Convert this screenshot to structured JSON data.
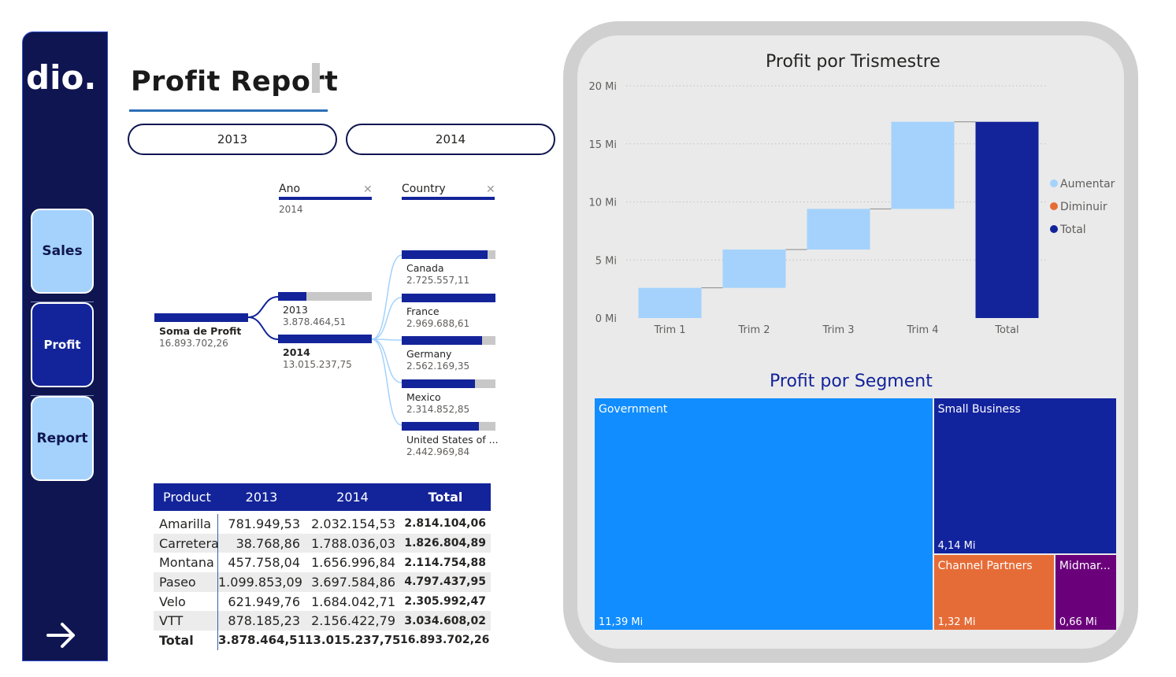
{
  "sidebar": {
    "logo_text": "dio.",
    "nav": [
      {
        "label": "Sales"
      },
      {
        "label": "Profit"
      },
      {
        "label": "Report"
      }
    ]
  },
  "header": {
    "title": "Profit Report"
  },
  "year_buttons": [
    "2013",
    "2014"
  ],
  "decomposition": {
    "levels": [
      {
        "label": "Ano",
        "selected": "2014"
      },
      {
        "label": "Country",
        "selected": ""
      }
    ],
    "root": {
      "name": "Soma de Profit",
      "value": "16.893.702,26"
    },
    "years": [
      {
        "name": "2013",
        "value": "3.878.464,51",
        "fill": 0.3
      },
      {
        "name": "2014",
        "value": "13.015.237,75",
        "fill": 1.0
      }
    ],
    "countries": [
      {
        "name": "Canada",
        "value": "2.725.557,11",
        "fill": 0.92
      },
      {
        "name": "France",
        "value": "2.969.688,61",
        "fill": 1.0
      },
      {
        "name": "Germany",
        "value": "2.562.169,35",
        "fill": 0.86
      },
      {
        "name": "Mexico",
        "value": "2.314.852,85",
        "fill": 0.78
      },
      {
        "name": "United States of ...",
        "value": "2.442.969,84",
        "fill": 0.82
      }
    ]
  },
  "table": {
    "headers": [
      "Product",
      "2013",
      "2014",
      "Total"
    ],
    "rows": [
      [
        "Amarilla",
        "781.949,53",
        "2.032.154,53",
        "2.814.104,06"
      ],
      [
        "Carretera",
        "38.768,86",
        "1.788.036,03",
        "1.826.804,89"
      ],
      [
        "Montana",
        "457.758,04",
        "1.656.996,84",
        "2.114.754,88"
      ],
      [
        "Paseo",
        "1.099.853,09",
        "3.697.584,86",
        "4.797.437,95"
      ],
      [
        "Velo",
        "621.949,76",
        "1.684.042,71",
        "2.305.992,47"
      ],
      [
        "VTT",
        "878.185,23",
        "2.156.422,79",
        "3.034.608,02"
      ]
    ],
    "total": [
      "Total",
      "3.878.464,51",
      "13.015.237,75",
      "16.893.702,26"
    ]
  },
  "waterfall_title": "Profit por Trismestre",
  "treemap_title": "Profit por Segment",
  "chart_data": [
    {
      "type": "bar",
      "subtype": "waterfall",
      "title": "Profit por Trismestre",
      "categories": [
        "Trim 1",
        "Trim 2",
        "Trim 3",
        "Trim 4",
        "Total"
      ],
      "steps": [
        2.6,
        3.3,
        3.5,
        7.5,
        16.9
      ],
      "kinds": [
        "Aumentar",
        "Aumentar",
        "Aumentar",
        "Aumentar",
        "Total"
      ],
      "ylim": [
        0,
        20
      ],
      "yticks": [
        0,
        5,
        10,
        15,
        20
      ],
      "ytick_labels": [
        "0 Mi",
        "5 Mi",
        "10 Mi",
        "15 Mi",
        "20 Mi"
      ],
      "legend": [
        {
          "name": "Aumentar",
          "color": "#a4d2fc"
        },
        {
          "name": "Diminuir",
          "color": "#e66c37"
        },
        {
          "name": "Total",
          "color": "#13249a"
        }
      ],
      "legend_position": "right",
      "grid": true
    },
    {
      "type": "treemap",
      "title": "Profit por Segment",
      "items": [
        {
          "name": "Government",
          "value": 11.39,
          "label": "11,39 Mi",
          "color": "#118dff"
        },
        {
          "name": "Small Business",
          "value": 4.14,
          "label": "4,14 Mi",
          "color": "#12239e"
        },
        {
          "name": "Channel Partners",
          "value": 1.32,
          "label": "1,32 Mi",
          "color": "#e66c37"
        },
        {
          "name": "Midmar...",
          "value": 0.66,
          "label": "0,66 Mi",
          "color": "#6b007b"
        }
      ]
    }
  ]
}
